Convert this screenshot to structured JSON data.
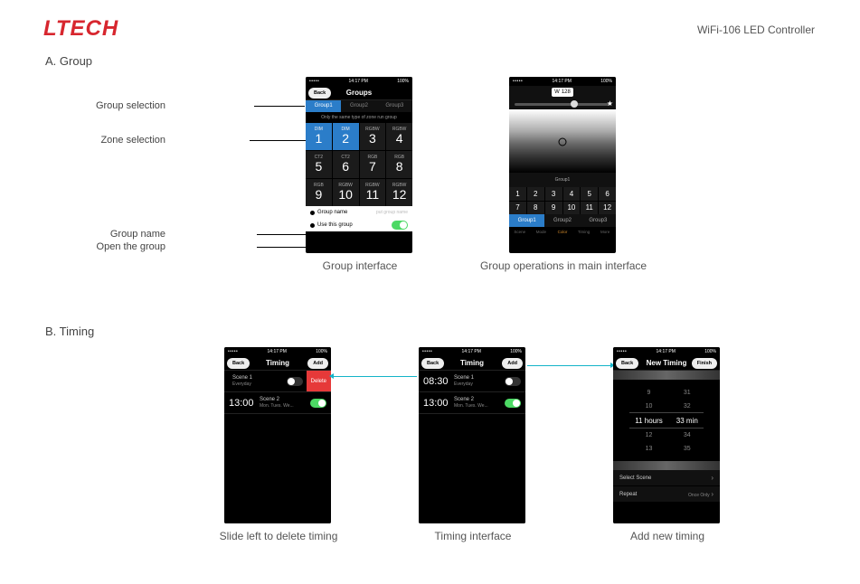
{
  "brand": "LTECH",
  "product": "WiFi-106 LED Controller",
  "sections": {
    "a": {
      "head": "A. Group",
      "cap1": "Group interface",
      "cap2": "Group operations in main interface"
    },
    "b": {
      "head": "B. Timing",
      "cap1": "Slide left to delete timing",
      "cap2": "Timing interface",
      "cap3": "Add new timing"
    }
  },
  "annotations": {
    "group_selection": "Group selection",
    "zone_selection": "Zone selection",
    "group_name": "Group name",
    "open_group": "Open the group"
  },
  "status": {
    "dots": "•••••",
    "time": "14:17 PM",
    "batt": "100%"
  },
  "groups_screen": {
    "back": "Back",
    "title": "Groups",
    "tabs": [
      "Group1",
      "Group2",
      "Group3"
    ],
    "hint": "Only the same type of zone run group",
    "cells": [
      {
        "l": "DIM",
        "n": "1"
      },
      {
        "l": "DIM",
        "n": "2"
      },
      {
        "l": "RGBW",
        "n": "3"
      },
      {
        "l": "RGBW",
        "n": "4"
      },
      {
        "l": "CT2",
        "n": "5"
      },
      {
        "l": "CT2",
        "n": "6"
      },
      {
        "l": "RGB",
        "n": "7"
      },
      {
        "l": "RGB",
        "n": "8"
      },
      {
        "l": "RGB",
        "n": "9"
      },
      {
        "l": "RGBW",
        "n": "10"
      },
      {
        "l": "RGBW",
        "n": "11"
      },
      {
        "l": "RGBW",
        "n": "12"
      }
    ],
    "name_lab": "Group name",
    "name_ph": "put group name",
    "use_lab": "Use this group"
  },
  "main_screen": {
    "w_lab": "W",
    "w_val": "128",
    "group_label": "Group1",
    "mini": [
      {
        "l": "",
        "n": "1"
      },
      {
        "l": "",
        "n": "2"
      },
      {
        "l": "",
        "n": "3"
      },
      {
        "l": "",
        "n": "4"
      },
      {
        "l": "",
        "n": "5"
      },
      {
        "l": "",
        "n": "6"
      },
      {
        "l": "",
        "n": "7"
      },
      {
        "l": "",
        "n": "8"
      },
      {
        "l": "",
        "n": "9"
      },
      {
        "l": "",
        "n": "10"
      },
      {
        "l": "",
        "n": "11"
      },
      {
        "l": "",
        "n": "12"
      }
    ],
    "gtabs": [
      "Group1",
      "Group2",
      "Group3"
    ],
    "nav": [
      "Scene",
      "Mode",
      "Color",
      "Timing",
      "More"
    ]
  },
  "timing": {
    "title": "Timing",
    "back": "Back",
    "add": "Add",
    "rows": [
      {
        "time": "",
        "scene": "Scene 1",
        "days": "Everyday",
        "on": false,
        "del": true
      },
      {
        "time": "13:00",
        "scene": "Scene 2",
        "days": "Mon. Tues. We...",
        "on": true,
        "del": false
      }
    ],
    "rows2": [
      {
        "time": "08:30",
        "scene": "Scene 1",
        "days": "Everyday",
        "on": false
      },
      {
        "time": "13:00",
        "scene": "Scene 2",
        "days": "Mon. Tues. We...",
        "on": true
      }
    ]
  },
  "new_timing": {
    "title": "New Timing",
    "back": "Back",
    "finish": "Finish",
    "hours": [
      "9",
      "10",
      "11",
      "12",
      "13"
    ],
    "mins": [
      "31",
      "32",
      "33",
      "34",
      "35"
    ],
    "h_unit": "hours",
    "m_unit": "min",
    "select_scene": "Select Scene",
    "repeat": "Repeat",
    "repeat_val": "Once Only"
  }
}
